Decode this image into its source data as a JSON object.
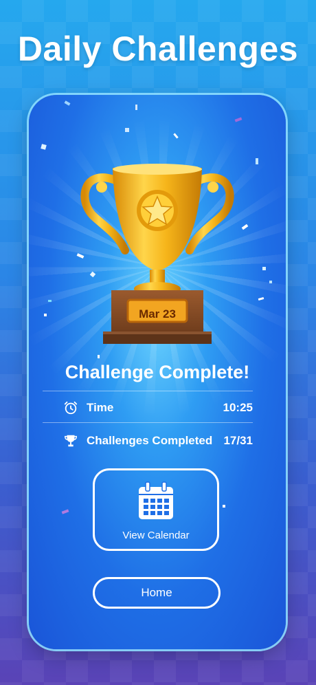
{
  "headline": "Daily Challenges",
  "trophy": {
    "plaque": "Mar 23"
  },
  "result": {
    "title": "Challenge Complete!",
    "time_label": "Time",
    "time_value": "10:25",
    "challenges_label": "Challenges Completed",
    "challenges_value": "17/31"
  },
  "buttons": {
    "calendar": "View Calendar",
    "home": "Home"
  },
  "colors": {
    "accent_gold": "#f2b417",
    "panel_blue": "#1f6fe6",
    "white": "#ffffff"
  },
  "icons": {
    "time": "alarm-clock-icon",
    "challenges": "trophy-icon",
    "calendar": "calendar-icon"
  }
}
